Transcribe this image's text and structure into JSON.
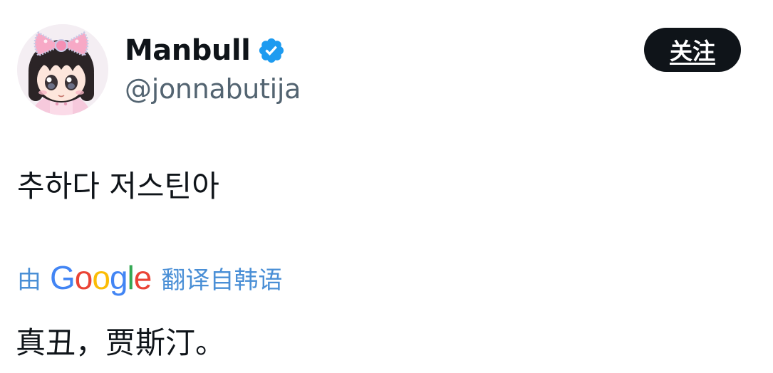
{
  "user": {
    "display_name": "Manbull",
    "handle": "@jonnabutija",
    "avatar_icon": "anime-girl-pink-bow-avatar",
    "verified_icon": "verified-badge-icon",
    "verified_color": "#1d9bf0"
  },
  "follow_button": {
    "label": "关注"
  },
  "tweet": {
    "text": "추하다 저스틴아"
  },
  "translation": {
    "by_label": "由",
    "provider": {
      "letters": [
        "G",
        "o",
        "o",
        "g",
        "l",
        "e"
      ],
      "colors": [
        "#4285f4",
        "#ea4335",
        "#fbbc05",
        "#4285f4",
        "#34a853",
        "#ea4335"
      ]
    },
    "from_label": "翻译自韩语",
    "text": "真丑，贾斯汀。"
  }
}
